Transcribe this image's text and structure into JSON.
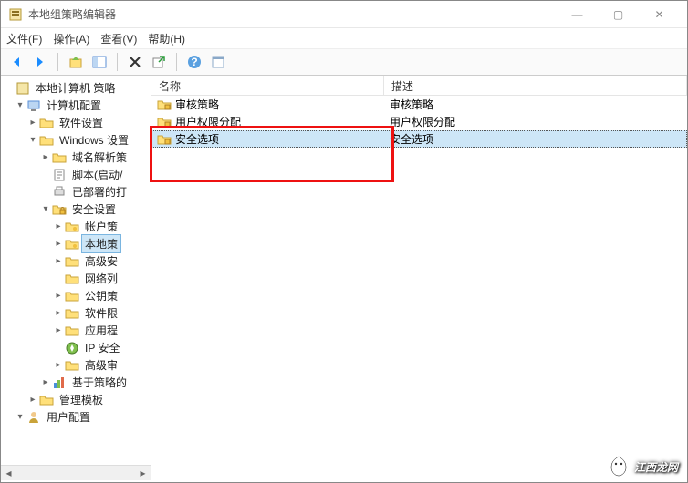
{
  "window": {
    "title": "本地组策略编辑器",
    "minimize": "—",
    "maximize": "▢",
    "close": "✕"
  },
  "menu": {
    "file": "文件(F)",
    "action": "操作(A)",
    "view": "查看(V)",
    "help": "帮助(H)"
  },
  "tree": {
    "root": "本地计算机 策略",
    "computer_config": "计算机配置",
    "software_settings": "软件设置",
    "windows_settings": "Windows 设置",
    "dns_policy": "域名解析策",
    "scripts": "脚本(启动/",
    "deployed": "已部署的打",
    "security_settings": "安全设置",
    "account_policy": "帐户策",
    "local_policy": "本地策",
    "advanced_security": "高级安",
    "network_list": "网络列",
    "public_key": "公钥策",
    "software_restriction": "软件限",
    "app_control": "应用程",
    "ip_security": "IP 安全",
    "advanced_audit": "高级审",
    "policy_based": "基于策略的",
    "admin_templates": "管理模板",
    "user_config": "用户配置"
  },
  "list": {
    "header_name": "名称",
    "header_desc": "描述",
    "rows": [
      {
        "name": "审核策略",
        "desc": "审核策略"
      },
      {
        "name": "用户权限分配",
        "desc": "用户权限分配"
      },
      {
        "name": "安全选项",
        "desc": "安全选项"
      }
    ]
  },
  "watermark": "江西龙网"
}
